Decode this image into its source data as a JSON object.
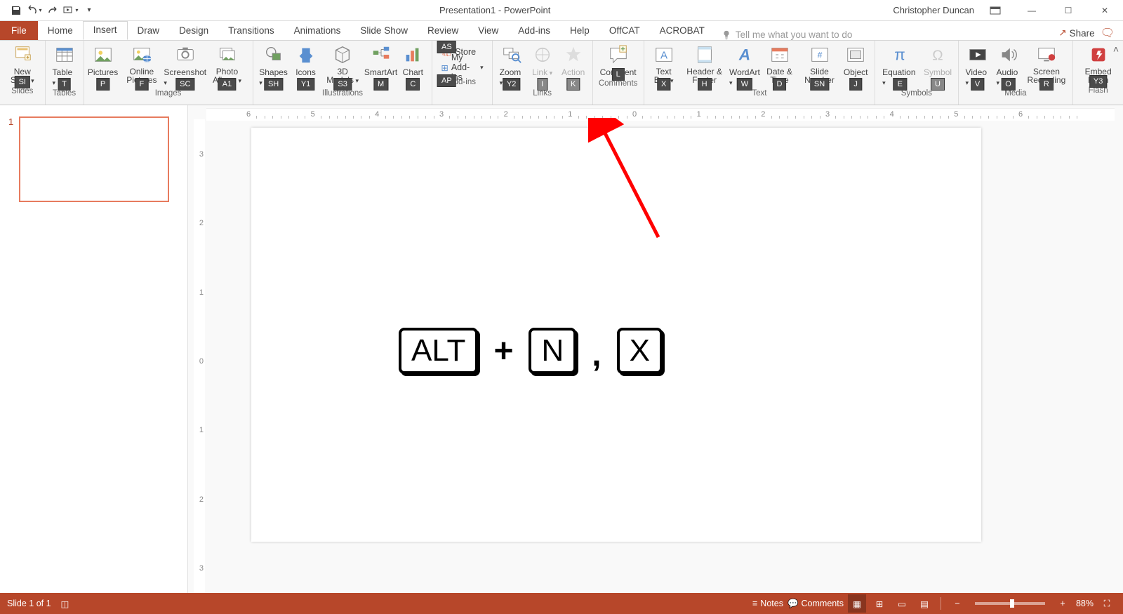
{
  "title": "Presentation1 - PowerPoint",
  "user": "Christopher Duncan",
  "tabs": {
    "file": "File",
    "home": "Home",
    "insert": "Insert",
    "draw": "Draw",
    "design": "Design",
    "transitions": "Transitions",
    "animations": "Animations",
    "slideshow": "Slide Show",
    "review": "Review",
    "view": "View",
    "addins": "Add-ins",
    "help": "Help",
    "offcat": "OffCAT",
    "acrobat": "ACROBAT"
  },
  "tellme_placeholder": "Tell me what you want to do",
  "share_label": "Share",
  "ribbon": {
    "new_slide": "New Slide",
    "table": "Table",
    "pictures": "Pictures",
    "online_pictures": "Online Pictures",
    "screenshot": "Screenshot",
    "photo_album": "Photo Album",
    "shapes": "Shapes",
    "icons": "Icons",
    "models3d": "3D Models",
    "smartart": "SmartArt",
    "chart": "Chart",
    "store": "Store",
    "my_addins": "My Add-ins",
    "zoom": "Zoom",
    "link": "Link",
    "action": "Action",
    "comment": "Comment",
    "text_box": "Text Box",
    "header_footer": "Header & Footer",
    "wordart": "WordArt",
    "date_time": "Date & Time",
    "slide_number": "Slide Number",
    "object": "Object",
    "equation": "Equation",
    "symbol": "Symbol",
    "video": "Video",
    "audio": "Audio",
    "screen_recording": "Screen Recording",
    "embed_flash": "Embed Flash"
  },
  "group_labels": {
    "slides": "Slides",
    "tables": "Tables",
    "images": "Images",
    "illustrations": "Illustrations",
    "addins": "Add-ins",
    "links": "Links",
    "comments": "Comments",
    "text": "Text",
    "symbols": "Symbols",
    "media": "Media",
    "flash": "Flash"
  },
  "keytips": {
    "new_slide": "SI",
    "table": "T",
    "pictures": "P",
    "online_pictures": "F",
    "screenshot": "SC",
    "photo_album": "A1",
    "shapes": "SH",
    "icons": "Y1",
    "models3d": "S3",
    "smartart": "M",
    "chart": "C",
    "store_as": "AS",
    "my_addins": "AP",
    "zoom": "Y2",
    "link": "I",
    "action": "K",
    "comment": "L",
    "text_box": "X",
    "header_footer": "H",
    "wordart": "W",
    "date_time": "D",
    "slide_number": "SN",
    "object": "J",
    "equation": "E",
    "symbol": "U",
    "video": "V",
    "audio": "O",
    "screen_recording": "R",
    "embed_flash": "Y3"
  },
  "ruler_h_labels": [
    "6",
    "5",
    "4",
    "3",
    "2",
    "1",
    "0",
    "1",
    "2",
    "3",
    "4",
    "5",
    "6"
  ],
  "ruler_v_labels": [
    "3",
    "2",
    "1",
    "0",
    "1",
    "2",
    "3"
  ],
  "thumb_number": "1",
  "keycombo": {
    "alt": "ALT",
    "plus": "+",
    "n": "N",
    "comma": ",",
    "x": "X"
  },
  "status": {
    "slide_of": "Slide 1 of 1",
    "notes": "Notes",
    "comments": "Comments",
    "zoom_pct": "88%"
  }
}
